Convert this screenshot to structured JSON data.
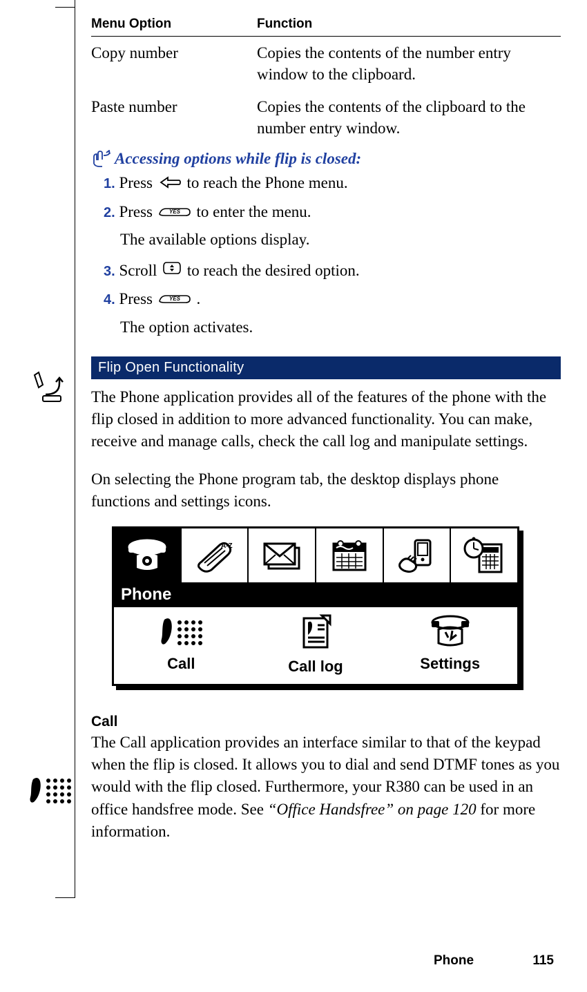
{
  "table": {
    "header_option": "Menu Option",
    "header_function": "Function",
    "rows": [
      {
        "option": "Copy number",
        "function": "Copies the contents of the number entry window to the clipboard."
      },
      {
        "option": "Paste number",
        "function": "Copies the contents of the clipboard to the number entry window."
      }
    ]
  },
  "tip": {
    "heading": "Accessing options while flip is closed:",
    "steps": {
      "s1_num": "1.",
      "s1_a": "Press ",
      "s1_b": " to reach the Phone menu.",
      "s2_num": "2.",
      "s2_a": "Press ",
      "s2_b": " to enter the menu.",
      "s2_result": "The available options display.",
      "s3_num": "3.",
      "s3_a": "Scroll ",
      "s3_b": " to reach the desired option.",
      "s4_num": "4.",
      "s4_a": "Press ",
      "s4_b": ".",
      "s4_result": "The option activates."
    }
  },
  "section": {
    "title": "Flip Open Functionality",
    "para1": "The Phone application provides all of the features of the phone with the flip closed in addition to more advanced functionality. You can make, receive and manage calls, check the call log and manipulate settings.",
    "para2": "On selecting the Phone program tab, the desktop displays phone functions and settings icons."
  },
  "desktop": {
    "selected_label": "Phone",
    "fn1": "Call",
    "fn2": "Call log",
    "fn3": "Settings"
  },
  "call_section": {
    "heading": "Call",
    "body_a": "The Call application provides an interface similar to that of the keypad when the flip is closed. It allows you to dial and send DTMF tones as you would with the flip closed. Furthermore, your R380 can be used in an office handsfree mode. See ",
    "body_ref": "“Office Handsfree” on page 120",
    "body_b": " for more information."
  },
  "footer": {
    "section": "Phone",
    "page": "115"
  },
  "keys": {
    "yes_label": "YES"
  }
}
